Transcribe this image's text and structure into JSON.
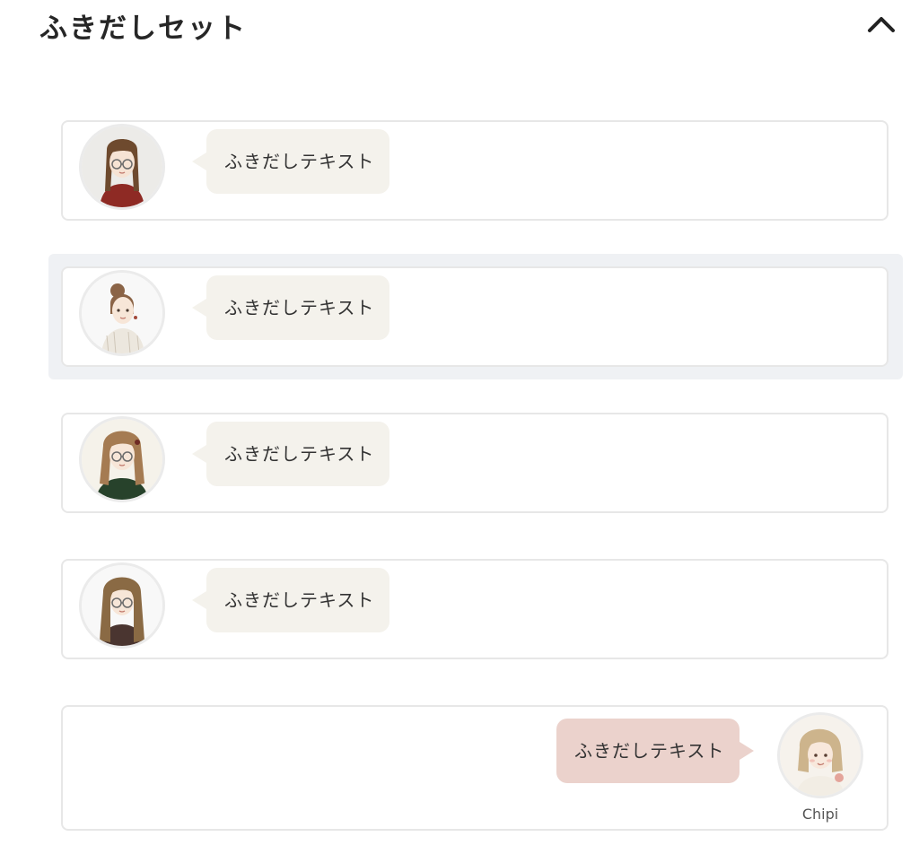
{
  "header": {
    "title": "ふきだしセット",
    "collapse_icon": "chevron-up-icon"
  },
  "items": [
    {
      "text": "ふきだしテキスト",
      "avatar": "girl-glasses-braids-red-sweater",
      "side": "left",
      "selected": false
    },
    {
      "text": "ふきだしテキスト",
      "avatar": "girl-bun-white-blouse",
      "side": "left",
      "selected": true
    },
    {
      "text": "ふきだしテキスト",
      "avatar": "girl-glasses-wavy-hair-green-shirt",
      "side": "left",
      "selected": false
    },
    {
      "text": "ふきだしテキスト",
      "avatar": "girl-glasses-long-wavy-hair",
      "side": "left",
      "selected": false
    },
    {
      "text": "ふきだしテキスト",
      "avatar": "girl-blonde-bob",
      "side": "right",
      "selected": false,
      "name": "Chipi"
    }
  ],
  "colors": {
    "bubble_left": "#f4f2ec",
    "bubble_right": "#ebd2cc",
    "card_border": "#e7e7e7",
    "selected_background": "#eff1f4",
    "title_text": "#262626"
  }
}
